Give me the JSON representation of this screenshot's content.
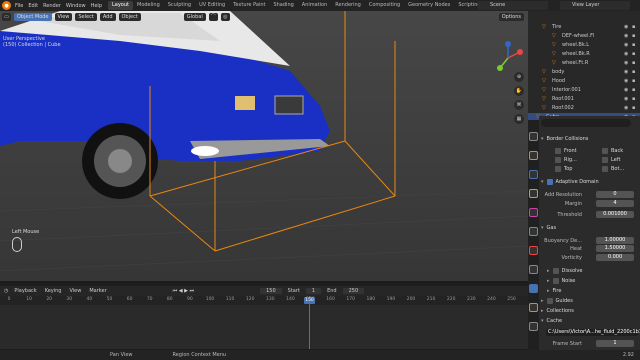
{
  "topbar": {
    "menus": [
      "File",
      "Edit",
      "Render",
      "Window",
      "Help"
    ],
    "workspaces": [
      "Layout",
      "Modeling",
      "Sculpting",
      "UV Editing",
      "Texture Paint",
      "Shading",
      "Animation",
      "Rendering",
      "Compositing",
      "Geometry Nodes",
      "Scripting"
    ],
    "active_workspace": "Layout",
    "scene": "Scene",
    "view_layer": "View Layer"
  },
  "viewport": {
    "mode": "Object Mode",
    "menus": [
      "View",
      "Select",
      "Add",
      "Object"
    ],
    "transform": "Global",
    "info_line1": "User Perspective",
    "info_line2": "(150) Collection | Cube",
    "hint_label": "Left Mouse",
    "options": "Options"
  },
  "outliner": {
    "rows": [
      {
        "name": "Tire",
        "indent": 14,
        "selected": false
      },
      {
        "name": "DEF-wheel.Fl",
        "indent": 24,
        "selected": false
      },
      {
        "name": "wheel.Bk.L",
        "indent": 24,
        "selected": false
      },
      {
        "name": "wheel.Bk.R",
        "indent": 24,
        "selected": false
      },
      {
        "name": "wheel.Ft.R",
        "indent": 24,
        "selected": false
      },
      {
        "name": "body",
        "indent": 14,
        "selected": false
      },
      {
        "name": "Hood",
        "indent": 14,
        "selected": false
      },
      {
        "name": "Interior.001",
        "indent": 14,
        "selected": false
      },
      {
        "name": "Roof.001",
        "indent": 14,
        "selected": false
      },
      {
        "name": "Roof.002",
        "indent": 14,
        "selected": false
      },
      {
        "name": "Cube",
        "indent": 8,
        "selected": true
      }
    ]
  },
  "properties": {
    "border_collisions": "Border Collisions",
    "checks": [
      {
        "left": "Front",
        "right": "Back"
      },
      {
        "left": "Rig...",
        "right": "Left"
      },
      {
        "left": "Top",
        "right": "Bot..."
      }
    ],
    "adaptive_domain": "Adaptive Domain",
    "add_resolution_label": "Add Resolution",
    "add_resolution": "0",
    "margin_label": "Margin",
    "margin": "4",
    "threshold_label": "Threshold",
    "threshold": "0.001000",
    "gas": "Gas",
    "buoyancy_label": "Buoyancy De...",
    "buoyancy": "1.00000",
    "heat_label": "Heat",
    "heat": "1.50000",
    "vorticity_label": "Vorticity",
    "vorticity": "0.000",
    "dissolve": "Dissolve",
    "noise": "Noise",
    "fire": "Fire",
    "guides": "Guides",
    "collections": "Collections",
    "cache": "Cache",
    "cache_path": "C:\\Users\\Victor\\A...he_fluid_2200c1b1",
    "frame_start_label": "Frame Start",
    "frame_start": "1",
    "end_label": "End",
    "end": "250"
  },
  "timeline": {
    "menus": [
      "Playback",
      "Keying",
      "View",
      "Marker"
    ],
    "current_frame": "150",
    "start_label": "Start",
    "start": "1",
    "end_label": "End",
    "end": "250",
    "ticks": [
      "0",
      "10",
      "20",
      "30",
      "40",
      "50",
      "60",
      "70",
      "80",
      "90",
      "100",
      "110",
      "120",
      "130",
      "140",
      "150",
      "160",
      "170",
      "180",
      "190",
      "200",
      "210",
      "220",
      "230",
      "240",
      "250"
    ]
  },
  "statusbar": {
    "items": [
      "Pan View",
      "Region Context Menu"
    ],
    "version": "2.92"
  },
  "colors": {
    "accent": "#4772b3",
    "orange": "#e87d0d",
    "car_blue": "#1a2fc4"
  }
}
